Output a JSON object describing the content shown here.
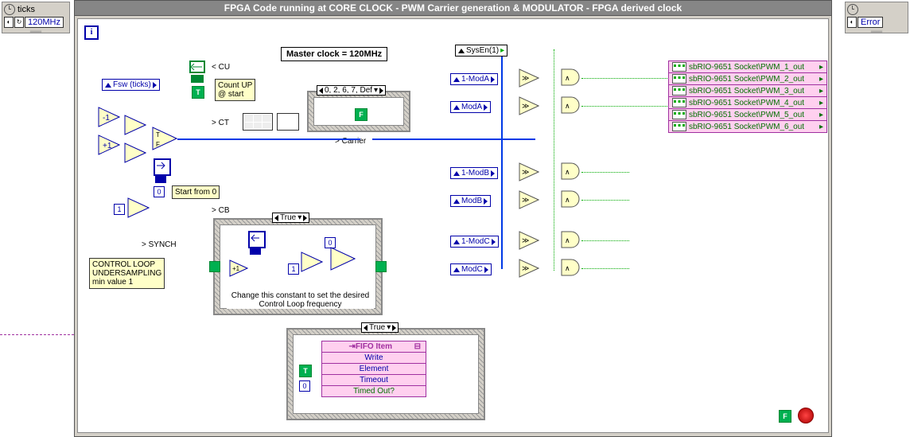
{
  "left_panel": {
    "title": "ticks",
    "value": "120MHz"
  },
  "right_panel": {
    "title": "Error"
  },
  "header": "FPGA Code running at CORE CLOCK - PWM Carrier generation & MODULATOR - FPGA derived clock",
  "master_clock": "Master clock = 120MHz",
  "fsw": "Fsw (ticks)",
  "labels": {
    "cu": "< CU",
    "ct": "> CT",
    "carrier": "> Carrier",
    "cb": "> CB",
    "synch": "> SYNCH",
    "start_from_0": "Start from 0",
    "count_up": "Count UP\n@ start"
  },
  "undersampling": "CONTROL LOOP\nUNDERSAMPLING\nmin value 1",
  "case1": "0, 2, 6, 7, Def",
  "case2": "True",
  "case3": "True",
  "change_const": "Change this constant to set the\ndesired Control Loop frequency",
  "sysen": "SysEn(1)",
  "mods": {
    "m1a": "1-ModA",
    "ma": "ModA",
    "m1b": "1-ModB",
    "mb": "ModB",
    "m1c": "1-ModC",
    "mc": "ModC"
  },
  "pwm_outs": [
    "sbRIO-9651 Socket\\PWM_1_out",
    "sbRIO-9651 Socket\\PWM_2_out",
    "sbRIO-9651 Socket\\PWM_3_out",
    "sbRIO-9651 Socket\\PWM_4_out",
    "sbRIO-9651 Socket\\PWM_5_out",
    "sbRIO-9651 Socket\\PWM_6_out"
  ],
  "fifo": {
    "hdr": "FIFO Item",
    "r1": "Write",
    "r2": "Element",
    "r3": "Timeout",
    "r4": "Timed Out?"
  },
  "consts": {
    "zero": "0",
    "one": "1",
    "F": "F",
    "T": "T",
    "minus1": "-1",
    "plus1": "+1"
  }
}
